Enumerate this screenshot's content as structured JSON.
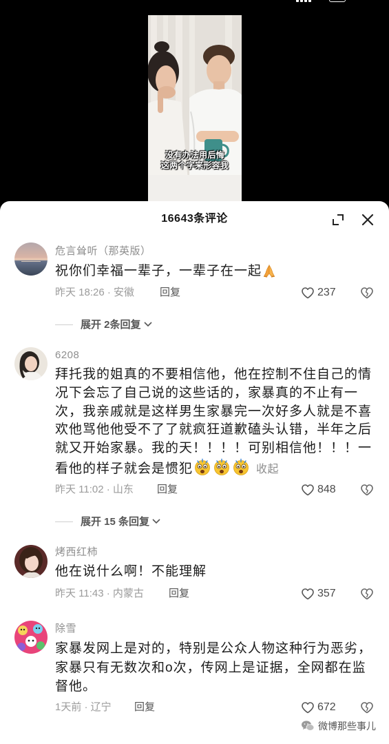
{
  "colors": {
    "page_bg": "#000000",
    "sheet_bg": "#ffffff",
    "text_primary": "#1c1c1c",
    "text_secondary": "#9b9b9b"
  },
  "video": {
    "subtitle_lines": [
      "没有办法用后悔",
      "这两个字来形容我"
    ]
  },
  "sheet": {
    "title": "16643条评论",
    "icons": [
      "expand-icon",
      "close-icon"
    ]
  },
  "comments": [
    {
      "avatar": "sunset-sea-avatar",
      "name": "危言耸听（那英版）",
      "lines": [
        "祝你们幸福一辈子，一辈子在一起"
      ],
      "emoji": [
        "pray-emoji"
      ],
      "meta": "昨天 18:26 · 安徽",
      "reply_label": "回复",
      "likes": "237",
      "icons": [
        "heart-icon",
        "dislike-icon"
      ]
    },
    {
      "avatar": "woman-portrait-avatar",
      "name": "6208",
      "lines": [
        "拜托我的姐真的不要相信他，他在控制不住自己的情",
        "况下会忘了自己说的这些话的，家暴真的不止有一",
        "次，我亲戚就是这样男生家暴完一次好多人就是不喜",
        "欢他骂他他受不了了就疯狂道歉磕头认错，半年之后",
        "就又开始家暴。我的天！！！！可别相信他！！！一",
        "看他的样子就会是惯犯"
      ],
      "emoji": [
        "shocked-emoji",
        "shocked-emoji",
        "shocked-emoji"
      ],
      "collapse_label": "收起",
      "meta": "昨天 11:02 · 山东",
      "reply_label": "回复",
      "likes": "848",
      "icons": [
        "heart-icon",
        "dislike-icon"
      ]
    },
    {
      "avatar": "woman-selfie-avatar",
      "name": "烤西红柿",
      "lines": [
        "他在说什么啊！不能理解"
      ],
      "meta": "昨天 11:43 · 内蒙古",
      "reply_label": "回复",
      "likes": "357",
      "icons": [
        "heart-icon",
        "dislike-icon"
      ]
    },
    {
      "avatar": "cartoon-pattern-avatar",
      "name": "除雪",
      "lines": [
        "家暴发网上是对的，特别是公众人物这种行为恶劣，",
        "家暴只有无数次和o次，传网上是证据，全网都在监",
        "督他。"
      ],
      "meta": "1天前 · 辽宁",
      "reply_label": "回复",
      "likes": "672",
      "icons": [
        "heart-icon",
        "dislike-icon"
      ]
    }
  ],
  "reply_expanders": [
    {
      "label": "展开 2条回复",
      "icon": "chevron-down-icon"
    },
    {
      "label": "展开 15 条回复",
      "icon": "chevron-down-icon"
    }
  ],
  "watermark": {
    "text": "微博那些事儿",
    "icon": "wechat-icon"
  }
}
